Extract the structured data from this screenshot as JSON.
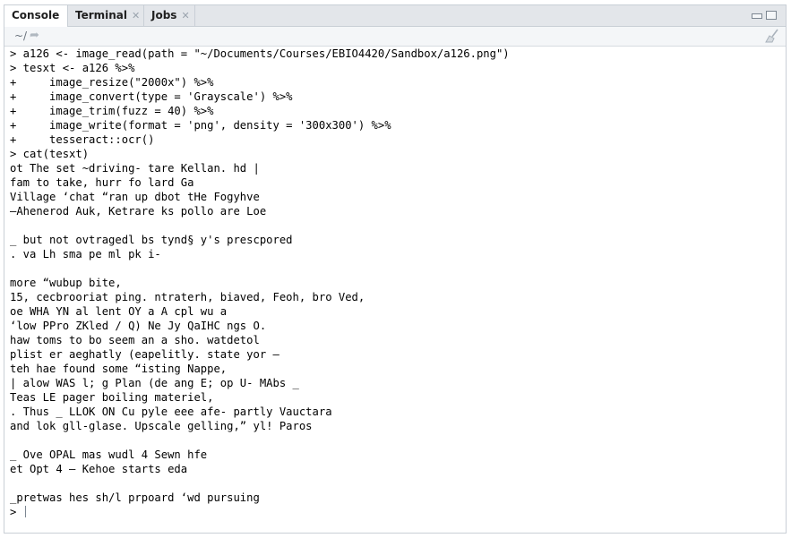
{
  "tabs": [
    {
      "label": "Console",
      "active": true,
      "closable": false
    },
    {
      "label": "Terminal",
      "active": false,
      "closable": true
    },
    {
      "label": "Jobs",
      "active": false,
      "closable": true
    }
  ],
  "toolbar": {
    "path": "~/",
    "path_arrow_icon": "go-to-directory-icon",
    "clear_icon": "broom-icon"
  },
  "console": {
    "lines": [
      {
        "kind": "input",
        "text": "> a126 <- image_read(path = \"~/Documents/Courses/EBIO4420/Sandbox/a126.png\")"
      },
      {
        "kind": "input",
        "text": "> tesxt <- a126 %>%"
      },
      {
        "kind": "input",
        "text": "+     image_resize(\"2000x\") %>%"
      },
      {
        "kind": "input",
        "text": "+     image_convert(type = 'Grayscale') %>%"
      },
      {
        "kind": "input",
        "text": "+     image_trim(fuzz = 40) %>%"
      },
      {
        "kind": "input",
        "text": "+     image_write(format = 'png', density = '300x300') %>%"
      },
      {
        "kind": "input",
        "text": "+     tesseract::ocr()"
      },
      {
        "kind": "input",
        "text": "> cat(tesxt)"
      },
      {
        "kind": "output",
        "text": "ot The set ~driving- tare Kellan. hd |"
      },
      {
        "kind": "output",
        "text": "fam to take, hurr fo lard Ga"
      },
      {
        "kind": "output",
        "text": "Village ‘chat “ran up dbot tHe Fogyhve"
      },
      {
        "kind": "output",
        "text": "—Ahenerod Auk, Ketrare ks pollo are Loe"
      },
      {
        "kind": "output",
        "text": ""
      },
      {
        "kind": "output",
        "text": "_ but not ovtragedl bs tynd§ y's prescpored"
      },
      {
        "kind": "output",
        "text": ". va Lh sma pe ml pk i-"
      },
      {
        "kind": "output",
        "text": ""
      },
      {
        "kind": "output",
        "text": "more “wubup bite,"
      },
      {
        "kind": "output",
        "text": "15, cecbrooriat ping. ntraterh, biaved, Feoh, bro Ved,"
      },
      {
        "kind": "output",
        "text": "oe WHA YN al lent OY a A cpl wu a"
      },
      {
        "kind": "output",
        "text": "‘low PPro ZKled / Q) Ne Jy QaIHC ngs O."
      },
      {
        "kind": "output",
        "text": "haw toms to bo seem an a sho. watdetol"
      },
      {
        "kind": "output",
        "text": "plist er aeghatly (eapelitly. state yor —"
      },
      {
        "kind": "output",
        "text": "teh hae found some “isting Nappe,"
      },
      {
        "kind": "output",
        "text": "| alow WAS l; g Plan (de ang E; op U- MAbs _"
      },
      {
        "kind": "output",
        "text": "Teas LE pager boiling materiel,"
      },
      {
        "kind": "output",
        "text": ". Thus _ LLOK ON Cu pyle eee afe- partly Vauctara"
      },
      {
        "kind": "output",
        "text": "and lok gll-glase. Upscale gelling,” yl! Paros"
      },
      {
        "kind": "output",
        "text": ""
      },
      {
        "kind": "output",
        "text": "_ Ove OPAL mas wudl 4 Sewn hfe"
      },
      {
        "kind": "output",
        "text": "et Opt 4 — Kehoe starts eda"
      },
      {
        "kind": "output",
        "text": ""
      },
      {
        "kind": "output",
        "text": "_pretwas hes sh/l prpoard ‘wd pursuing"
      }
    ],
    "prompt": "> "
  },
  "colors": {
    "tabbar_bg": "#e3e6ea",
    "border": "#c9cfd6",
    "toolbar_bg": "#f4f6f8",
    "text": "#000000"
  }
}
